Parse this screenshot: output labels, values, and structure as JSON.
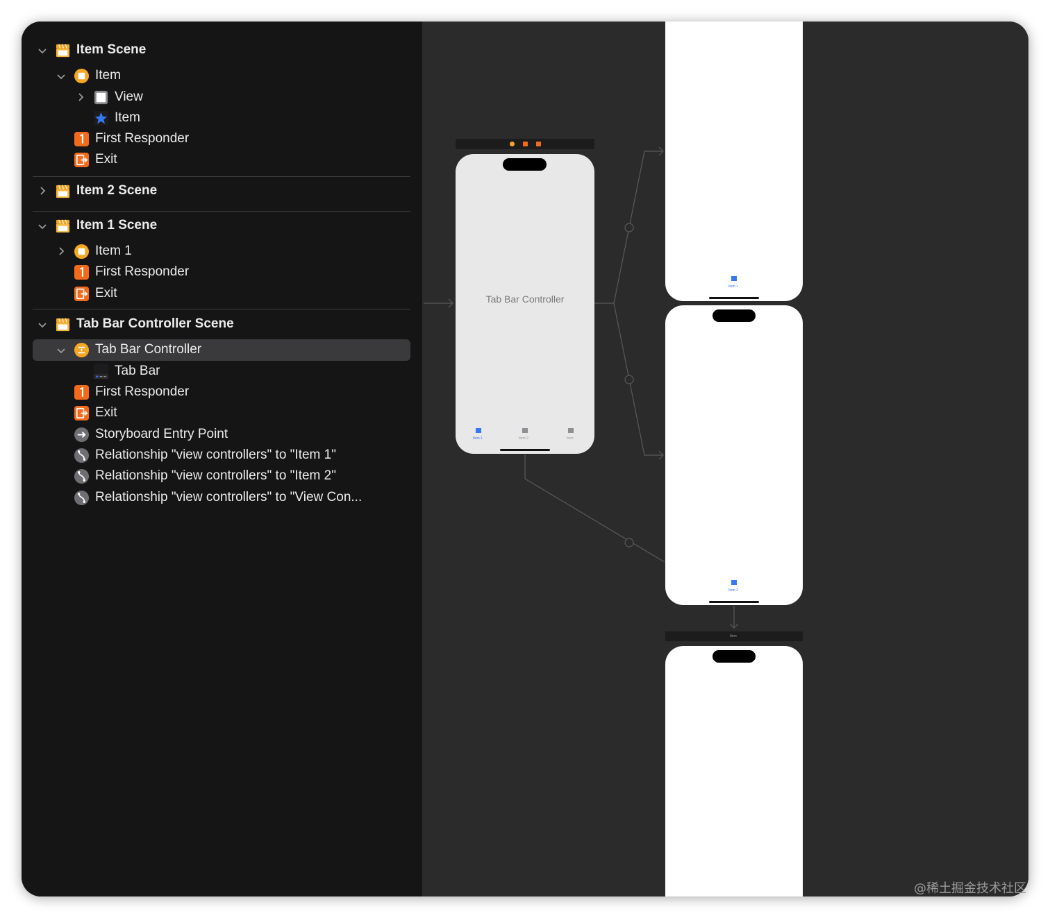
{
  "outline": {
    "item_scene": {
      "title": "Item Scene",
      "item": "Item",
      "view": "View",
      "tab_item": "Item",
      "first_responder": "First Responder",
      "exit": "Exit"
    },
    "item2_scene": {
      "title": "Item 2 Scene"
    },
    "item1_scene": {
      "title": "Item 1 Scene",
      "item": "Item 1",
      "first_responder": "First Responder",
      "exit": "Exit"
    },
    "tbc_scene": {
      "title": "Tab Bar Controller Scene",
      "controller": "Tab Bar Controller",
      "tab_bar": "Tab Bar",
      "first_responder": "First Responder",
      "exit": "Exit",
      "entry_point": "Storyboard Entry Point",
      "rel1": "Relationship \"view controllers\" to \"Item 1\"",
      "rel2": "Relationship \"view controllers\" to \"Item 2\"",
      "rel3": "Relationship \"view controllers\" to \"View Con..."
    }
  },
  "canvas": {
    "tab_bar_controller_label": "Tab Bar Controller",
    "tab_labels": [
      "Item 1",
      "Item 2",
      "Item"
    ],
    "item1_tab_label": "Item 1",
    "item2_tab_label": "Item 2",
    "item_scene_bar_label": "Item"
  },
  "colors": {
    "accent_orange": "#f5a623",
    "responder_orange": "#f26a1b",
    "tab_blue": "#3478f6"
  },
  "watermark": "@稀土掘金技术社区"
}
